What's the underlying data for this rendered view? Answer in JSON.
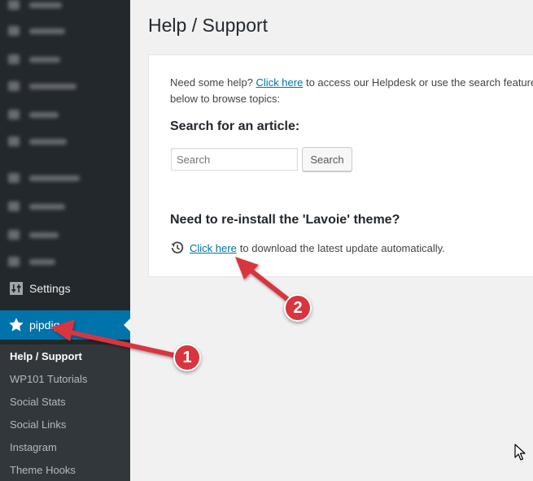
{
  "sidebar": {
    "settings_label": "Settings",
    "active_label": "pipdig",
    "submenu": [
      "Help / Support",
      "WP101 Tutorials",
      "Social Stats",
      "Social Links",
      "Instagram",
      "Theme Hooks"
    ]
  },
  "page": {
    "title": "Help / Support",
    "intro_prefix": "Need some help?",
    "intro_link": "Click here",
    "intro_suffix": "to access our Helpdesk or use the search feature below to browse topics:",
    "search_heading": "Search for an article:",
    "search_placeholder": "Search",
    "search_button": "Search",
    "reinstall_heading": "Need to re-install the 'Lavoie' theme?",
    "update_link": "Click here",
    "update_suffix": "to download the latest update automatically."
  },
  "annotations": {
    "badge_1": "1",
    "badge_2": "2",
    "arrow_color": "#d9353f"
  },
  "colors": {
    "sidebar_bg": "#23282d",
    "active_bg": "#0073aa",
    "link": "#0073aa"
  }
}
